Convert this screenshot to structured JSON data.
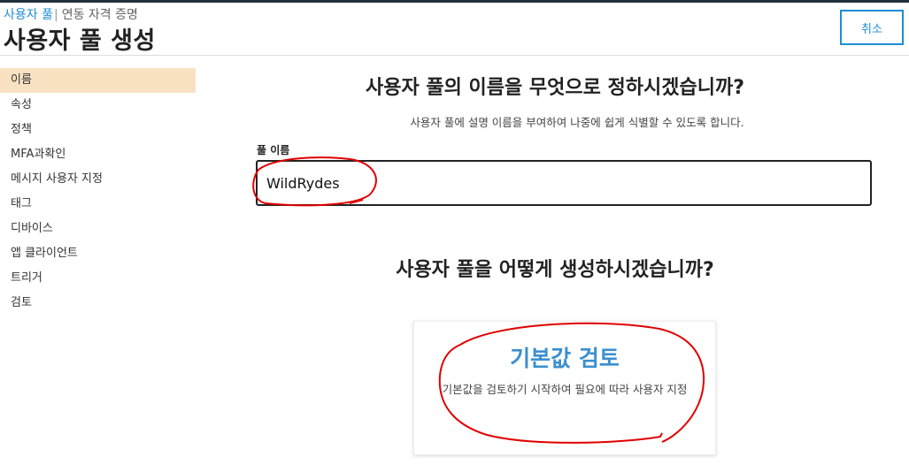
{
  "header": {
    "breadcrumb": {
      "link": "사용자 풀",
      "separator": "|",
      "current": "연동 자격 증명"
    },
    "title": "사용자 풀 생성",
    "cancel_label": "취소"
  },
  "sidebar": {
    "items": [
      {
        "label": "이름",
        "active": true
      },
      {
        "label": "속성",
        "active": false
      },
      {
        "label": "정책",
        "active": false
      },
      {
        "label": "MFA과확인",
        "active": false
      },
      {
        "label": "메시지 사용자 지정",
        "active": false
      },
      {
        "label": "태그",
        "active": false
      },
      {
        "label": "디바이스",
        "active": false
      },
      {
        "label": "앱 클라이언트",
        "active": false
      },
      {
        "label": "트리거",
        "active": false
      },
      {
        "label": "검토",
        "active": false
      }
    ]
  },
  "main": {
    "name_heading": "사용자 풀의 이름을 무엇으로 정하시겠습니까?",
    "name_description": "사용자 풀에 설명 이름을 부여하여 나중에 쉽게 식별할 수 있도록 합니다.",
    "pool_name": {
      "label": "풀 이름",
      "value": "WildRydes"
    },
    "create_heading": "사용자 풀을 어떻게 생성하시겠습니까?",
    "review_card": {
      "title": "기본값 검토",
      "text": "기본값을 검토하기 시작하여 필요에 따라 사용자 지정"
    }
  },
  "colors": {
    "accent": "#1f8dd6",
    "active_nav": "#f9e2c2",
    "card_title": "#3b8fd0",
    "annotation": "#e00000"
  }
}
